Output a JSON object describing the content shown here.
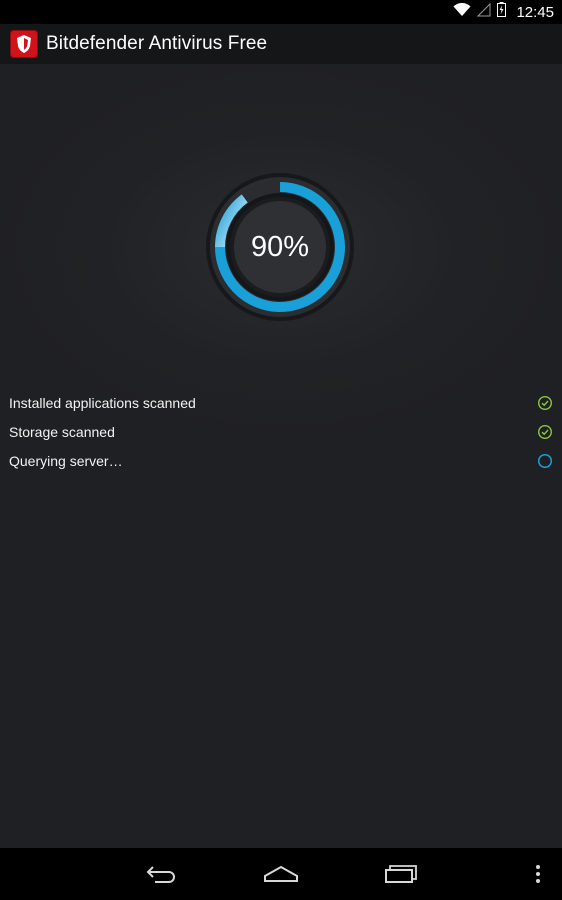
{
  "status_bar": {
    "time": "12:45"
  },
  "action_bar": {
    "title": "Bitdefender Antivirus Free"
  },
  "scan": {
    "progress_label": "90%",
    "progress_value": 0.9,
    "steps": [
      {
        "label": "Installed applications scanned",
        "state": "done"
      },
      {
        "label": "Storage scanned",
        "state": "done"
      },
      {
        "label": "Querying server…",
        "state": "in-progress"
      }
    ]
  },
  "colors": {
    "accent": "#1aa0d8",
    "check": "#8bc53f",
    "brand_red": "#d1121a"
  },
  "icons": {
    "app": "bitdefender-shield-icon",
    "wifi": "wifi-icon",
    "signal": "cell-signal-icon",
    "battery": "battery-charging-icon",
    "back": "back-icon",
    "home": "home-icon",
    "recents": "recent-apps-icon",
    "overflow": "overflow-menu-icon"
  }
}
